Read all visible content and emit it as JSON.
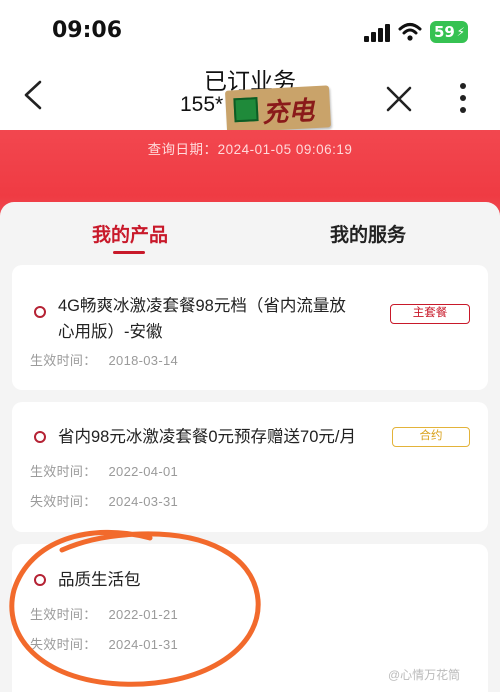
{
  "status_bar": {
    "time": "09:06",
    "battery": "59"
  },
  "nav": {
    "title": "已订业务",
    "subtitle": "155*",
    "sticker_text": "充电"
  },
  "banner": {
    "query_label": "查询日期：",
    "query_date": "2024-01-05 09:06:19"
  },
  "tabs": [
    {
      "label": "我的产品",
      "active": true
    },
    {
      "label": "我的服务",
      "active": false
    }
  ],
  "products": [
    {
      "title_line1": "4G畅爽冰激凌套餐98元档（省内流量放",
      "title_line2": "心用版）-安徽",
      "tag": "主套餐",
      "effective_label": "生效时间：",
      "effective_date": "2018-03-14"
    },
    {
      "title_line1": "省内98元冰激凌套餐0元预存赠送70元/月",
      "tag": "合约",
      "effective_label": "生效时间：",
      "effective_date": "2022-04-01",
      "expiry_label": "失效时间：",
      "expiry_date": "2024-03-31"
    },
    {
      "title_line1": "品质生活包",
      "effective_label": "生效时间：",
      "effective_date": "2022-01-21",
      "expiry_label": "失效时间：",
      "expiry_date": "2024-01-31"
    }
  ],
  "watermark": "@心情万花筒",
  "colors": {
    "accent_red": "#c8192a",
    "banner_red": "#ef3b43",
    "contract_gold": "#d9a21b",
    "annotation_orange": "#f26a2c"
  }
}
